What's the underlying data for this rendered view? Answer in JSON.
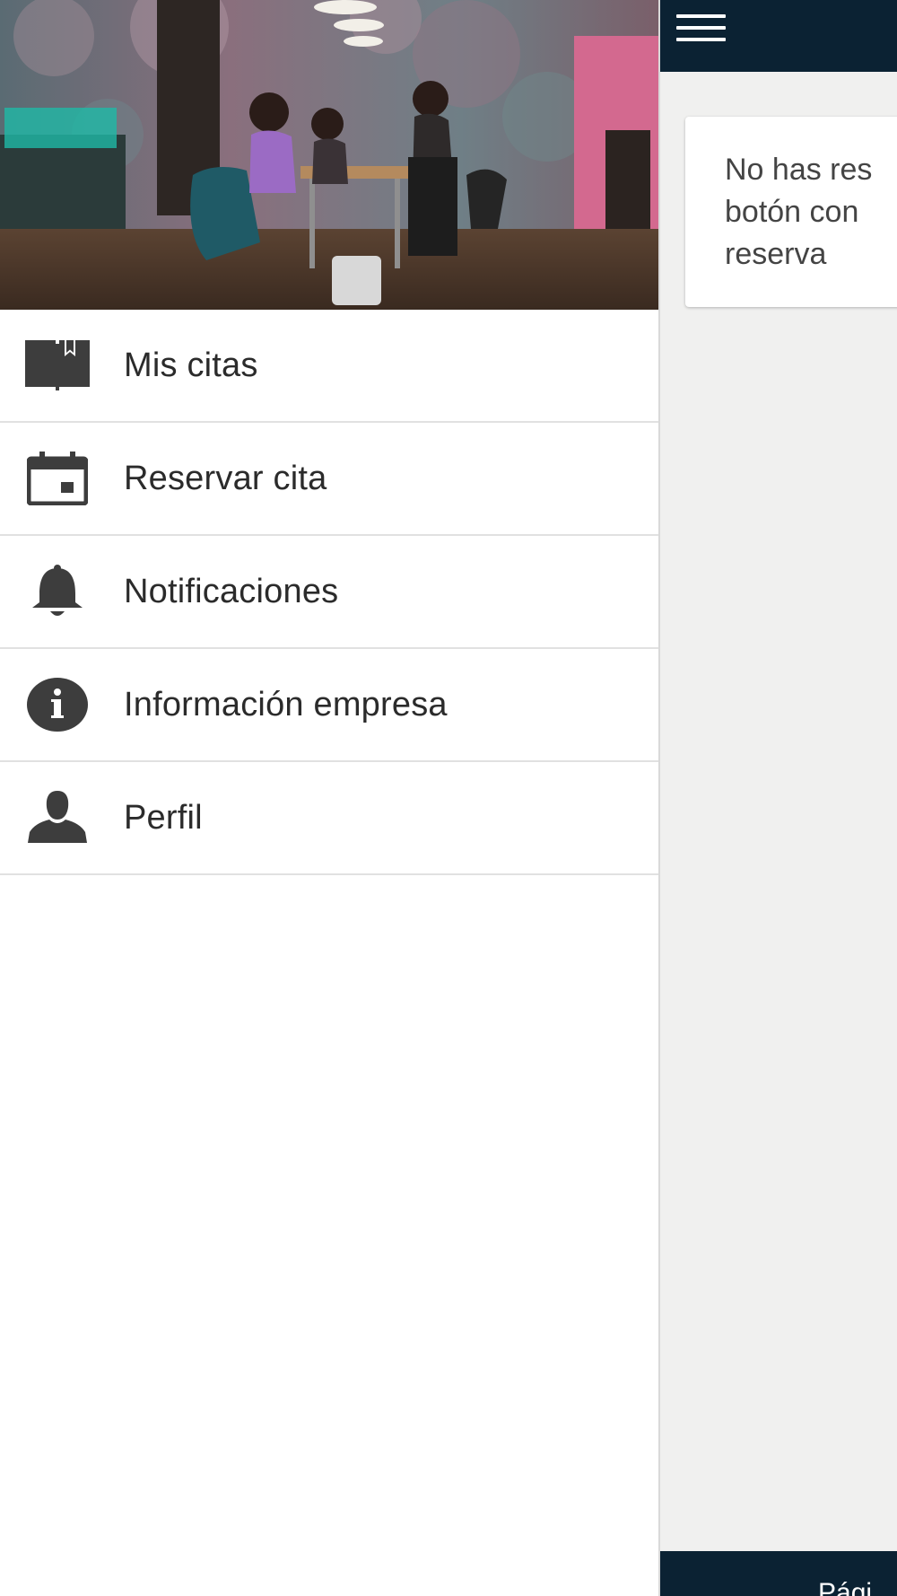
{
  "main": {
    "empty_message": "No has res\nbotón con\nreserva",
    "footer_text": "Pági",
    "colors": {
      "bar": "#0b2233",
      "background": "#f0f0ef"
    }
  },
  "drawer": {
    "header_image": "salon-interior-photo",
    "items": [
      {
        "label": "Mis citas",
        "icon": "book-icon"
      },
      {
        "label": "Reservar cita",
        "icon": "calendar-icon"
      },
      {
        "label": "Notificaciones",
        "icon": "bell-icon"
      },
      {
        "label": "Información empresa",
        "icon": "info-icon"
      },
      {
        "label": "Perfil",
        "icon": "person-icon"
      }
    ]
  }
}
